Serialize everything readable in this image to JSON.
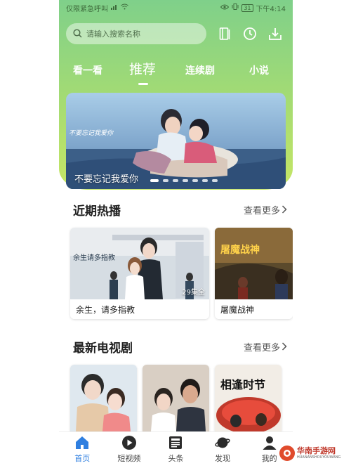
{
  "status_bar": {
    "carrier_text": "仅限紧急呼叫",
    "battery": "31",
    "time": "下午4:14"
  },
  "search": {
    "placeholder": "请输入搜索名称"
  },
  "header_icons": [
    "bookshelf-icon",
    "history-icon",
    "download-icon"
  ],
  "tabs": [
    {
      "label": "看一看",
      "active": false
    },
    {
      "label": "推荐",
      "active": true
    },
    {
      "label": "连续剧",
      "active": false
    },
    {
      "label": "小说",
      "active": false
    }
  ],
  "banner": {
    "title": "不要忘记我爱你",
    "artwork_text": "不要忘记我爱你",
    "dots_total": 7,
    "active_dot": 0
  },
  "recent_hot": {
    "title": "近期热播",
    "more": "查看更多",
    "items": [
      {
        "title": "余生，请多指教",
        "badge": "29集全",
        "artwork_text": "余生请多指教"
      },
      {
        "title": "屠魔战神",
        "artwork_text": "屠魔战神"
      }
    ]
  },
  "latest_tv": {
    "title": "最新电视剧",
    "more": "查看更多",
    "items": [
      {
        "artwork_text": ""
      },
      {
        "artwork_text": ""
      },
      {
        "artwork_text": "相逢时节"
      }
    ]
  },
  "bottom_nav": [
    {
      "label": "首页",
      "icon": "home-icon",
      "active": true
    },
    {
      "label": "短视频",
      "icon": "play-circle-icon",
      "active": false
    },
    {
      "label": "头条",
      "icon": "news-icon",
      "active": false
    },
    {
      "label": "发现",
      "icon": "planet-icon",
      "active": false
    },
    {
      "label": "我的",
      "icon": "user-icon",
      "active": false
    }
  ],
  "watermark": {
    "main": "华南手游网",
    "sub": "HUANANSHOUYOUWANG"
  },
  "colors": {
    "header_top": "#7fd08a",
    "header_bottom": "#c6e665",
    "nav_active": "#2f7fe0"
  }
}
